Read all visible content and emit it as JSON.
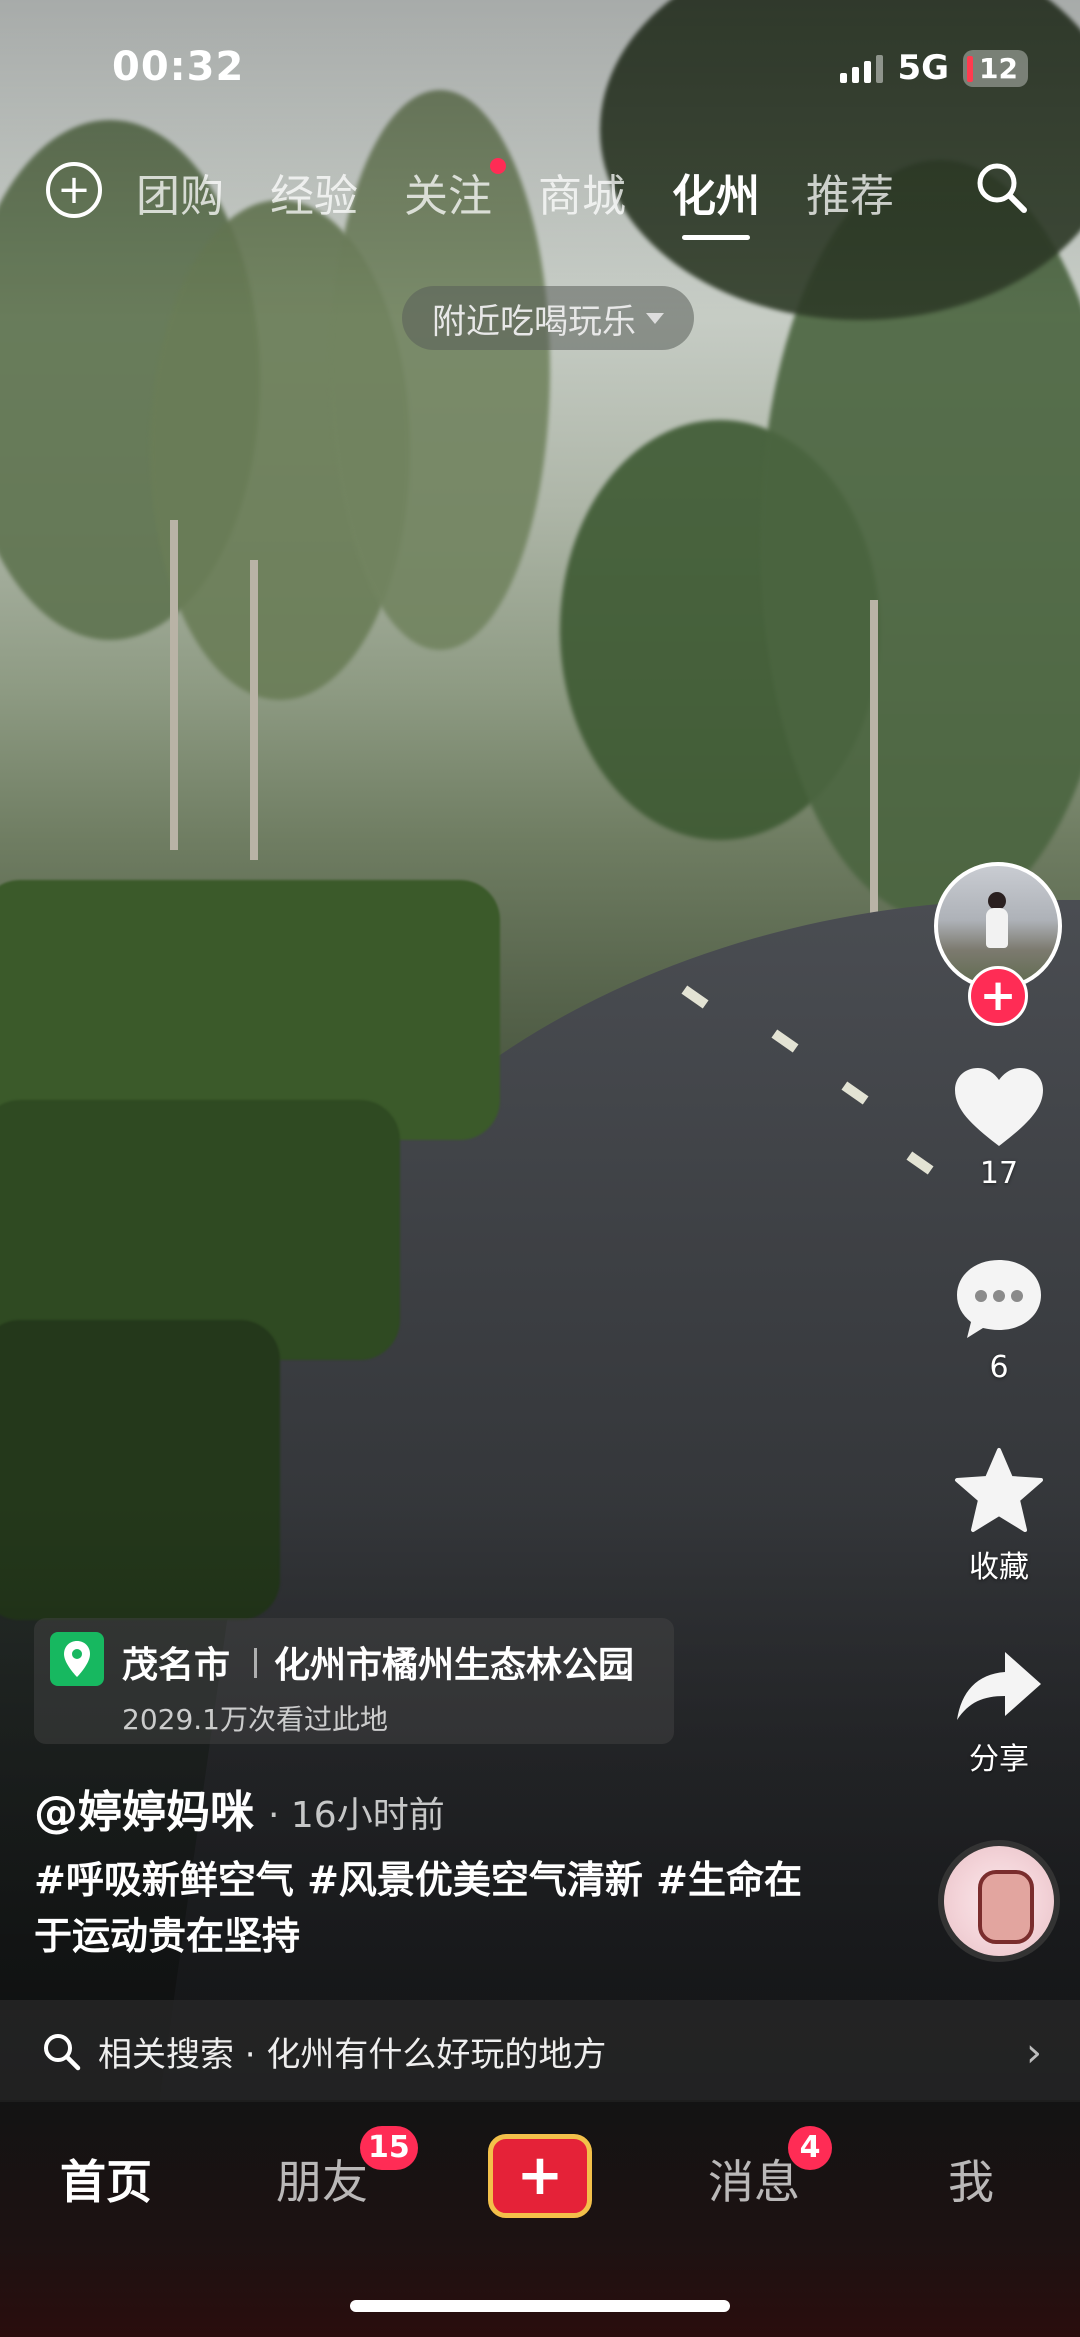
{
  "status_bar": {
    "time": "00:32",
    "network": "5G",
    "battery": "12"
  },
  "top_tabs": {
    "items": [
      {
        "label": "团购"
      },
      {
        "label": "经验"
      },
      {
        "label": "关注",
        "has_dot": true
      },
      {
        "label": "商城"
      },
      {
        "label": "化州",
        "active": true
      },
      {
        "label": "推荐"
      }
    ],
    "filter_chip": "附近吃喝玩乐"
  },
  "right_rail": {
    "like_count": "17",
    "comment_count": "6",
    "favorite_label": "收藏",
    "share_label": "分享"
  },
  "location": {
    "city": "茂名市",
    "place": "化州市橘州生态林公园",
    "views": "2029.1万次看过此地"
  },
  "post": {
    "author": "@婷婷妈咪",
    "time_ago": "· 16小时前",
    "description": "#呼吸新鲜空气 #风景优美空气清新 #生命在于运动贵在坚持"
  },
  "related_search": {
    "text": "相关搜索 · 化州有什么好玩的地方"
  },
  "bottom_nav": {
    "home": "首页",
    "friends": "朋友",
    "friends_badge": "15",
    "messages": "消息",
    "messages_badge": "4",
    "me": "我"
  },
  "colors": {
    "accent_red": "#ff2c55",
    "location_green": "#17b860",
    "create_border": "#f3c04a"
  }
}
